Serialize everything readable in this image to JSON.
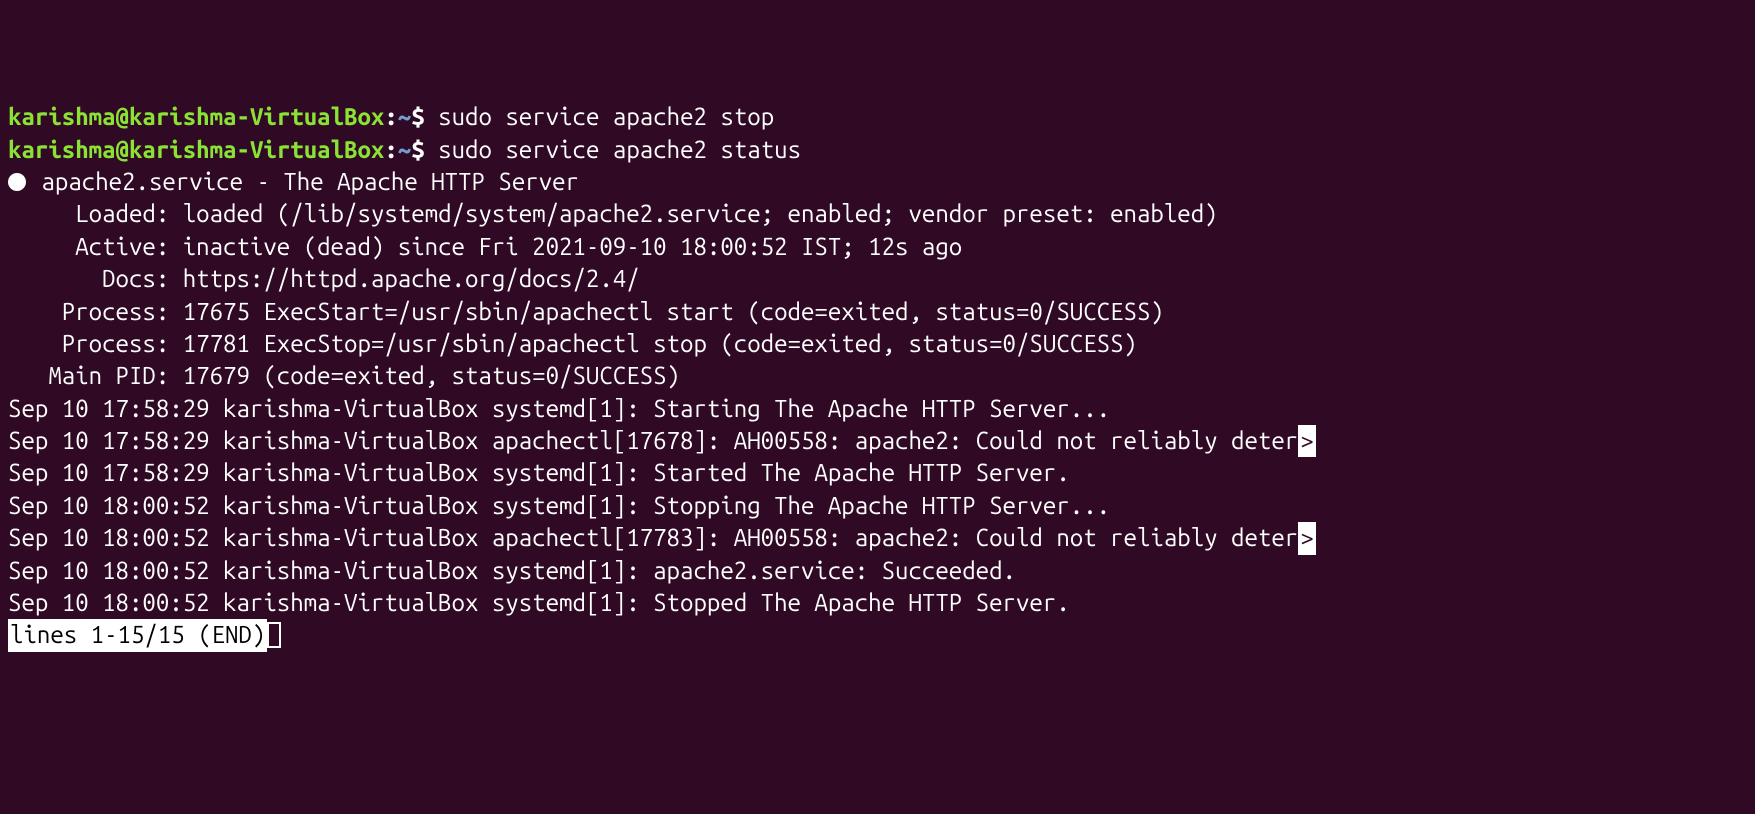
{
  "prompt": {
    "user": "karishma",
    "at": "@",
    "host": "karishma-VirtualBox",
    "colon": ":",
    "path": "~",
    "dollar": "$"
  },
  "commands": {
    "c1": "sudo service apache2 stop",
    "c2": "sudo service apache2 status"
  },
  "status": {
    "header_rest": " apache2.service - The Apache HTTP Server",
    "loaded": "     Loaded: loaded (/lib/systemd/system/apache2.service; enabled; vendor preset: enabled)",
    "active": "     Active: inactive (dead) since Fri 2021-09-10 18:00:52 IST; 12s ago",
    "docs": "       Docs: https://httpd.apache.org/docs/2.4/",
    "process1": "    Process: 17675 ExecStart=/usr/sbin/apachectl start (code=exited, status=0/SUCCESS)",
    "process2": "    Process: 17781 ExecStop=/usr/sbin/apachectl stop (code=exited, status=0/SUCCESS)",
    "mainpid": "   Main PID: 17679 (code=exited, status=0/SUCCESS)",
    "blank": ""
  },
  "logs": {
    "l1": "Sep 10 17:58:29 karishma-VirtualBox systemd[1]: Starting The Apache HTTP Server...",
    "l2": "Sep 10 17:58:29 karishma-VirtualBox apachectl[17678]: AH00558: apache2: Could not reliably deter",
    "l3": "Sep 10 17:58:29 karishma-VirtualBox systemd[1]: Started The Apache HTTP Server.",
    "l4": "Sep 10 18:00:52 karishma-VirtualBox systemd[1]: Stopping The Apache HTTP Server...",
    "l5": "Sep 10 18:00:52 karishma-VirtualBox apachectl[17783]: AH00558: apache2: Could not reliably deter",
    "l6": "Sep 10 18:00:52 karishma-VirtualBox systemd[1]: apache2.service: Succeeded.",
    "l7": "Sep 10 18:00:52 karishma-VirtualBox systemd[1]: Stopped The Apache HTTP Server."
  },
  "truncate": ">",
  "pager": "lines 1-15/15 (END)"
}
